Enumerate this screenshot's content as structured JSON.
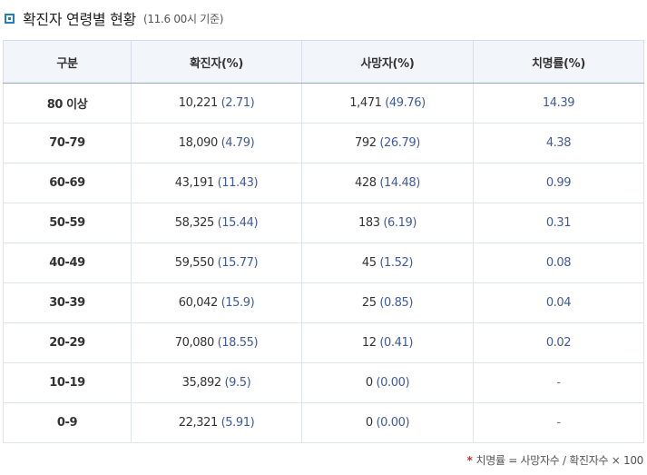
{
  "header": {
    "title": "확진자 연령별 현황",
    "subtitle": "(11.6 00시 기준)"
  },
  "table": {
    "columns": [
      "구분",
      "확진자(%)",
      "사망자(%)",
      "치명률(%)"
    ],
    "rows": [
      {
        "age": "80 이상",
        "cases": "10,221",
        "cases_pct": "(2.71)",
        "deaths": "1,471",
        "deaths_pct": "(49.76)",
        "fatality": "14.39"
      },
      {
        "age": "70-79",
        "cases": "18,090",
        "cases_pct": "(4.79)",
        "deaths": "792",
        "deaths_pct": "(26.79)",
        "fatality": "4.38"
      },
      {
        "age": "60-69",
        "cases": "43,191",
        "cases_pct": "(11.43)",
        "deaths": "428",
        "deaths_pct": "(14.48)",
        "fatality": "0.99"
      },
      {
        "age": "50-59",
        "cases": "58,325",
        "cases_pct": "(15.44)",
        "deaths": "183",
        "deaths_pct": "(6.19)",
        "fatality": "0.31"
      },
      {
        "age": "40-49",
        "cases": "59,550",
        "cases_pct": "(15.77)",
        "deaths": "45",
        "deaths_pct": "(1.52)",
        "fatality": "0.08"
      },
      {
        "age": "30-39",
        "cases": "60,042",
        "cases_pct": "(15.9)",
        "deaths": "25",
        "deaths_pct": "(0.85)",
        "fatality": "0.04"
      },
      {
        "age": "20-29",
        "cases": "70,080",
        "cases_pct": "(18.55)",
        "deaths": "12",
        "deaths_pct": "(0.41)",
        "fatality": "0.02"
      },
      {
        "age": "10-19",
        "cases": "35,892",
        "cases_pct": "(9.5)",
        "deaths": "0",
        "deaths_pct": "(0.00)",
        "fatality": "-"
      },
      {
        "age": "0-9",
        "cases": "22,321",
        "cases_pct": "(5.91)",
        "deaths": "0",
        "deaths_pct": "(0.00)",
        "fatality": "-"
      }
    ]
  },
  "footnote": {
    "marker": "*",
    "text": "치명률 = 사망자수 / 확진자수 × 100"
  },
  "colors": {
    "accent": "#1e7fc2",
    "value_blue": "#3f5a9e",
    "header_bg": "#f2f5fa",
    "footnote_marker": "#d9262c"
  },
  "icons": {
    "title_bullet": "square-bullet-icon"
  }
}
